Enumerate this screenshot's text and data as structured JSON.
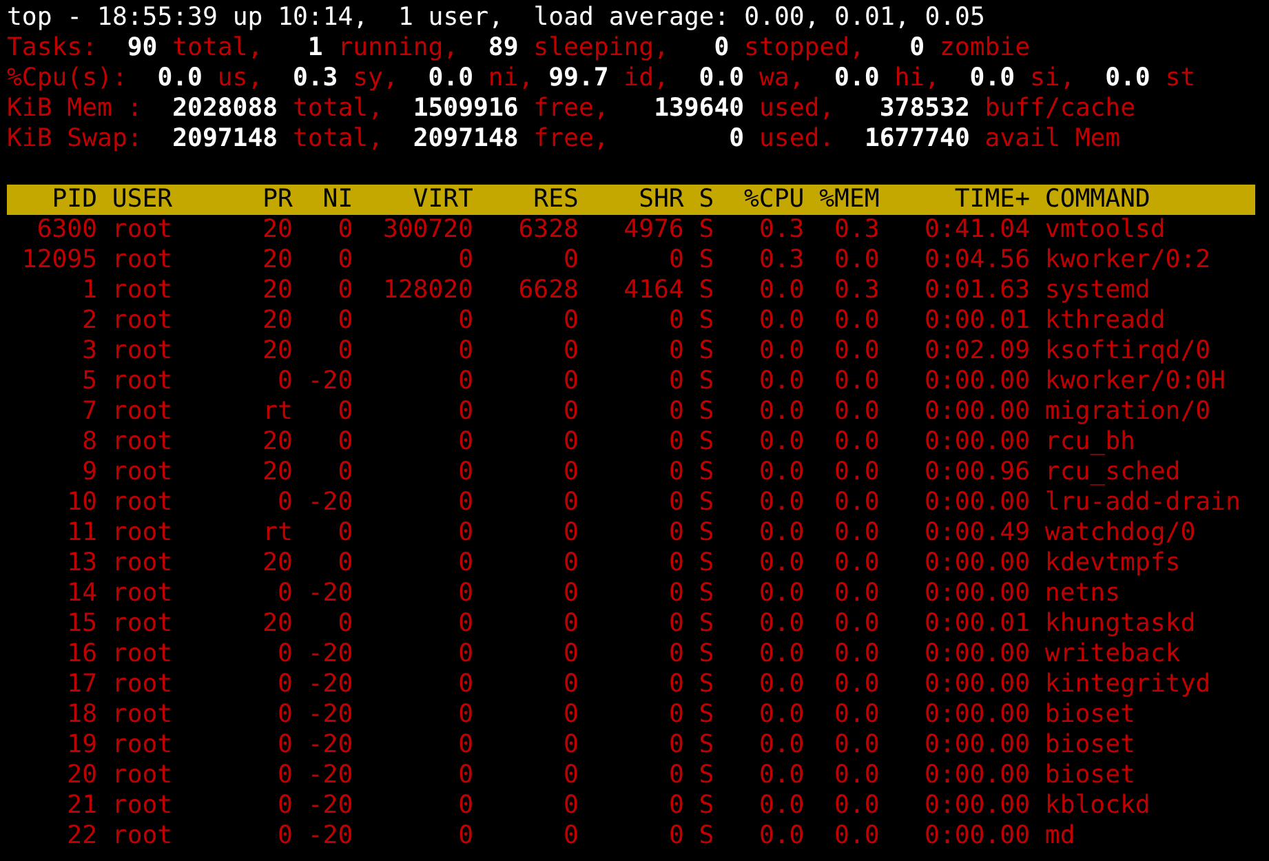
{
  "summary": {
    "title": "top - 18:55:39 up 10:14,  1 user,  load average: 0.00, 0.01, 0.05",
    "lines": [
      {
        "segments": [
          {
            "kind": "label",
            "text": "Tasks:"
          },
          {
            "kind": "number",
            "text": "90"
          },
          {
            "kind": "label",
            "text": "total,"
          },
          {
            "kind": "number",
            "text": "1"
          },
          {
            "kind": "label",
            "text": "running,"
          },
          {
            "kind": "number",
            "text": "89"
          },
          {
            "kind": "label",
            "text": "sleeping,"
          },
          {
            "kind": "number",
            "text": "0"
          },
          {
            "kind": "label",
            "text": "stopped,"
          },
          {
            "kind": "number",
            "text": "0"
          },
          {
            "kind": "label",
            "text": "zombie"
          }
        ]
      },
      {
        "segments": [
          {
            "kind": "label",
            "text": "%Cpu(s):"
          },
          {
            "kind": "number",
            "text": "0.0"
          },
          {
            "kind": "label",
            "text": "us,"
          },
          {
            "kind": "number",
            "text": "0.3"
          },
          {
            "kind": "label",
            "text": "sy,"
          },
          {
            "kind": "number",
            "text": "0.0"
          },
          {
            "kind": "label",
            "text": "ni,"
          },
          {
            "kind": "number",
            "text": "99.7"
          },
          {
            "kind": "label",
            "text": "id,"
          },
          {
            "kind": "number",
            "text": "0.0"
          },
          {
            "kind": "label",
            "text": "wa,"
          },
          {
            "kind": "number",
            "text": "0.0"
          },
          {
            "kind": "label",
            "text": "hi,"
          },
          {
            "kind": "number",
            "text": "0.0"
          },
          {
            "kind": "label",
            "text": "si,"
          },
          {
            "kind": "number",
            "text": "0.0"
          },
          {
            "kind": "label",
            "text": "st"
          }
        ]
      },
      {
        "segments": [
          {
            "kind": "label",
            "text": "KiB Mem :"
          },
          {
            "kind": "number",
            "text": "2028088"
          },
          {
            "kind": "label",
            "text": "total,"
          },
          {
            "kind": "number",
            "text": "1509916"
          },
          {
            "kind": "label",
            "text": "free,"
          },
          {
            "kind": "number",
            "text": "139640"
          },
          {
            "kind": "label",
            "text": "used,"
          },
          {
            "kind": "number",
            "text": "378532"
          },
          {
            "kind": "label",
            "text": "buff/cache"
          }
        ]
      },
      {
        "segments": [
          {
            "kind": "label",
            "text": "KiB Swap:"
          },
          {
            "kind": "number",
            "text": "2097148"
          },
          {
            "kind": "label",
            "text": "total,"
          },
          {
            "kind": "number",
            "text": "2097148"
          },
          {
            "kind": "label",
            "text": "free,"
          },
          {
            "kind": "number",
            "text": "0"
          },
          {
            "kind": "label",
            "text": "used."
          },
          {
            "kind": "number",
            "text": "1677740"
          },
          {
            "kind": "label",
            "text": "avail Mem"
          }
        ]
      }
    ]
  },
  "table": {
    "columns": [
      "PID",
      "USER",
      "PR",
      "NI",
      "VIRT",
      "RES",
      "SHR",
      "S",
      "%CPU",
      "%MEM",
      "TIME+",
      "COMMAND"
    ],
    "rows": [
      [
        "6300",
        "root",
        "20",
        "0",
        "300720",
        "6328",
        "4976",
        "S",
        "0.3",
        "0.3",
        "0:41.04",
        "vmtoolsd"
      ],
      [
        "12095",
        "root",
        "20",
        "0",
        "0",
        "0",
        "0",
        "S",
        "0.3",
        "0.0",
        "0:04.56",
        "kworker/0:2"
      ],
      [
        "1",
        "root",
        "20",
        "0",
        "128020",
        "6628",
        "4164",
        "S",
        "0.0",
        "0.3",
        "0:01.63",
        "systemd"
      ],
      [
        "2",
        "root",
        "20",
        "0",
        "0",
        "0",
        "0",
        "S",
        "0.0",
        "0.0",
        "0:00.01",
        "kthreadd"
      ],
      [
        "3",
        "root",
        "20",
        "0",
        "0",
        "0",
        "0",
        "S",
        "0.0",
        "0.0",
        "0:02.09",
        "ksoftirqd/0"
      ],
      [
        "5",
        "root",
        "0",
        "-20",
        "0",
        "0",
        "0",
        "S",
        "0.0",
        "0.0",
        "0:00.00",
        "kworker/0:0H"
      ],
      [
        "7",
        "root",
        "rt",
        "0",
        "0",
        "0",
        "0",
        "S",
        "0.0",
        "0.0",
        "0:00.00",
        "migration/0"
      ],
      [
        "8",
        "root",
        "20",
        "0",
        "0",
        "0",
        "0",
        "S",
        "0.0",
        "0.0",
        "0:00.00",
        "rcu_bh"
      ],
      [
        "9",
        "root",
        "20",
        "0",
        "0",
        "0",
        "0",
        "S",
        "0.0",
        "0.0",
        "0:00.96",
        "rcu_sched"
      ],
      [
        "10",
        "root",
        "0",
        "-20",
        "0",
        "0",
        "0",
        "S",
        "0.0",
        "0.0",
        "0:00.00",
        "lru-add-drain"
      ],
      [
        "11",
        "root",
        "rt",
        "0",
        "0",
        "0",
        "0",
        "S",
        "0.0",
        "0.0",
        "0:00.49",
        "watchdog/0"
      ],
      [
        "13",
        "root",
        "20",
        "0",
        "0",
        "0",
        "0",
        "S",
        "0.0",
        "0.0",
        "0:00.00",
        "kdevtmpfs"
      ],
      [
        "14",
        "root",
        "0",
        "-20",
        "0",
        "0",
        "0",
        "S",
        "0.0",
        "0.0",
        "0:00.00",
        "netns"
      ],
      [
        "15",
        "root",
        "20",
        "0",
        "0",
        "0",
        "0",
        "S",
        "0.0",
        "0.0",
        "0:00.01",
        "khungtaskd"
      ],
      [
        "16",
        "root",
        "0",
        "-20",
        "0",
        "0",
        "0",
        "S",
        "0.0",
        "0.0",
        "0:00.00",
        "writeback"
      ],
      [
        "17",
        "root",
        "0",
        "-20",
        "0",
        "0",
        "0",
        "S",
        "0.0",
        "0.0",
        "0:00.00",
        "kintegrityd"
      ],
      [
        "18",
        "root",
        "0",
        "-20",
        "0",
        "0",
        "0",
        "S",
        "0.0",
        "0.0",
        "0:00.00",
        "bioset"
      ],
      [
        "19",
        "root",
        "0",
        "-20",
        "0",
        "0",
        "0",
        "S",
        "0.0",
        "0.0",
        "0:00.00",
        "bioset"
      ],
      [
        "20",
        "root",
        "0",
        "-20",
        "0",
        "0",
        "0",
        "S",
        "0.0",
        "0.0",
        "0:00.00",
        "bioset"
      ],
      [
        "21",
        "root",
        "0",
        "-20",
        "0",
        "0",
        "0",
        "S",
        "0.0",
        "0.0",
        "0:00.00",
        "kblockd"
      ],
      [
        "22",
        "root",
        "0",
        "-20",
        "0",
        "0",
        "0",
        "S",
        "0.0",
        "0.0",
        "0:00.00",
        "md"
      ]
    ]
  }
}
